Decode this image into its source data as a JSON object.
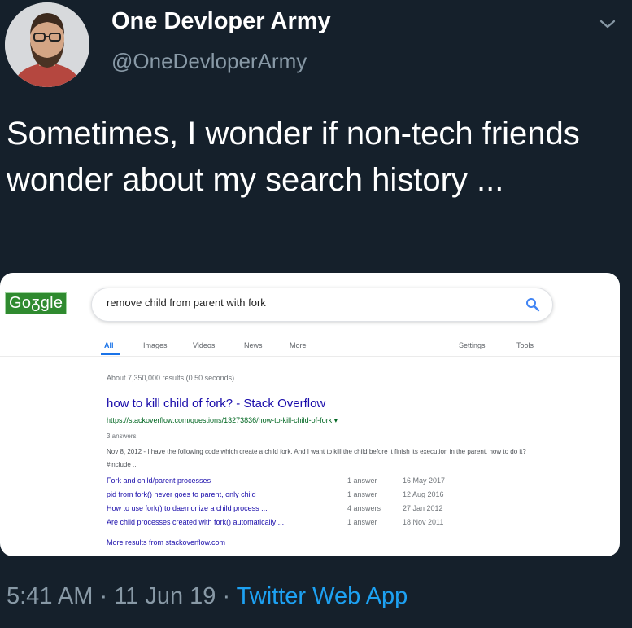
{
  "tweet": {
    "author_name": "One Devloper Army",
    "author_handle": "@OneDevloperArmy",
    "text": "Sometimes, I wonder if non-tech friends wonder about my search history ...",
    "time": "5:41 AM",
    "sep1": " · ",
    "date": "11 Jun 19",
    "sep2": " · ",
    "source": "Twitter Web App"
  },
  "google": {
    "logo_text": "Goᵹgle",
    "query": "remove child from parent with fork",
    "tabs": [
      "All",
      "Images",
      "Videos",
      "News",
      "More"
    ],
    "settings_label": "Settings",
    "tools_label": "Tools",
    "stats": "About 7,350,000 results (0.50 seconds)",
    "result": {
      "title": "how to kill child of fork? - Stack Overflow",
      "url": "https://stackoverflow.com/questions/13273836/how-to-kill-child-of-fork",
      "url_arrow": "▾",
      "answers": "3 answers",
      "snippet": "Nov 8, 2012 - I have the following code which create a child fork. And I want to kill the child before it finish its execution in the parent. how to do it? #include ...",
      "sub_results": [
        {
          "title": "Fork and child/parent processes",
          "answers": "1 answer",
          "date": "16 May 2017"
        },
        {
          "title": "pid from fork() never goes to parent, only child",
          "answers": "1 answer",
          "date": "12 Aug 2016"
        },
        {
          "title": "How to use fork() to daemonize a child process ...",
          "answers": "4 answers",
          "date": "27 Jan 2012"
        },
        {
          "title": "Are child processes created with fork() automatically ...",
          "answers": "1 answer",
          "date": "18 Nov 2011"
        }
      ],
      "more_results": "More results from stackoverflow.com"
    }
  },
  "icons": {
    "caret": "chevron-down-icon",
    "search": "search-icon",
    "avatar": "avatar"
  },
  "colors": {
    "background": "#15202b",
    "secondary_text": "#8899a6",
    "link_blue": "#1da1f2",
    "google_link": "#1a0dab",
    "google_url": "#006621",
    "google_logo_bg": "#2f8a2f"
  }
}
